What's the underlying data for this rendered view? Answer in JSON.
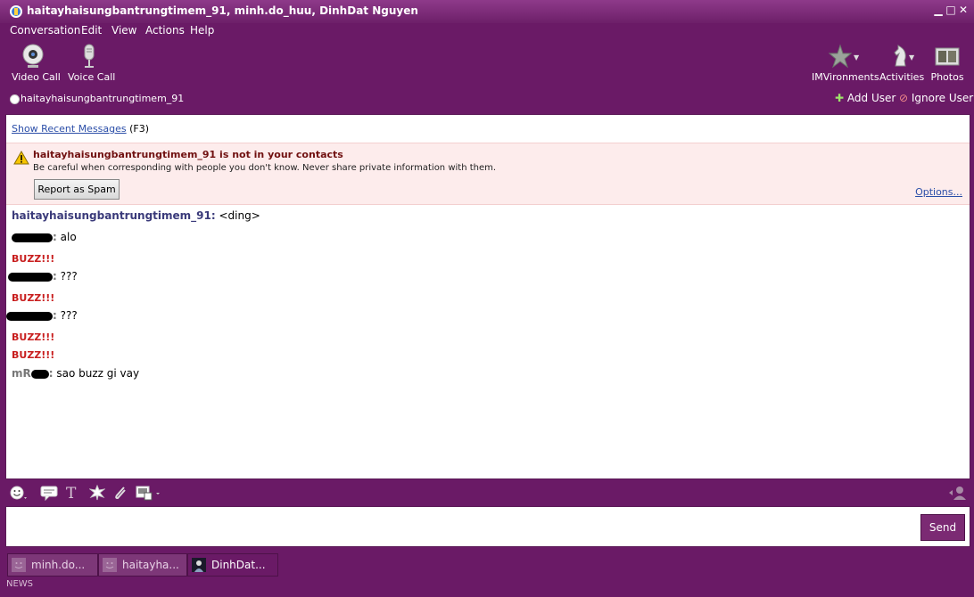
{
  "window": {
    "title": "haitayhaisungbantrungtimem_91, minh.do_huu, DinhDat Nguyen"
  },
  "menu": [
    "Conversation",
    "Edit",
    "View",
    "Actions",
    "Help"
  ],
  "toolbar": {
    "video_call": "Video Call",
    "voice_call": "Voice Call",
    "imvironments": "IMVironments",
    "activities": "Activities",
    "photos": "Photos"
  },
  "userbar": {
    "contact": "haitayhaisungbantrungtimem_91",
    "add_user": "Add User",
    "ignore_user": "Ignore User"
  },
  "recent": {
    "link": "Show Recent Messages",
    "shortcut": "(F3)"
  },
  "warning": {
    "title": "haitayhaisungbantrungtimem_91 is not in your contacts",
    "body": "Be careful when corresponding with people you don't know. Never share private information with them.",
    "spam_button": "Report as Spam",
    "options": "Options..."
  },
  "messages": {
    "m1": {
      "sender": "haitayhaisungbantrungtimem_91:",
      "text": "<ding>"
    },
    "m2": {
      "text": "alo"
    },
    "buzz": "BUZZ!!!",
    "m3": {
      "text": "???"
    },
    "m4": {
      "text": "???"
    },
    "m5": {
      "sender_prefix": "mR",
      "text": "sao buzz gi vay"
    }
  },
  "compose": {
    "send": "Send"
  },
  "tabs": [
    {
      "label": "minh.do..."
    },
    {
      "label": "haitayha..."
    },
    {
      "label": "DinhDat..."
    }
  ],
  "footer": {
    "news": "NEWS"
  },
  "colors": {
    "chrome": "#6a1a66",
    "buzz": "#c81e1e",
    "link": "#2b4ea8"
  }
}
